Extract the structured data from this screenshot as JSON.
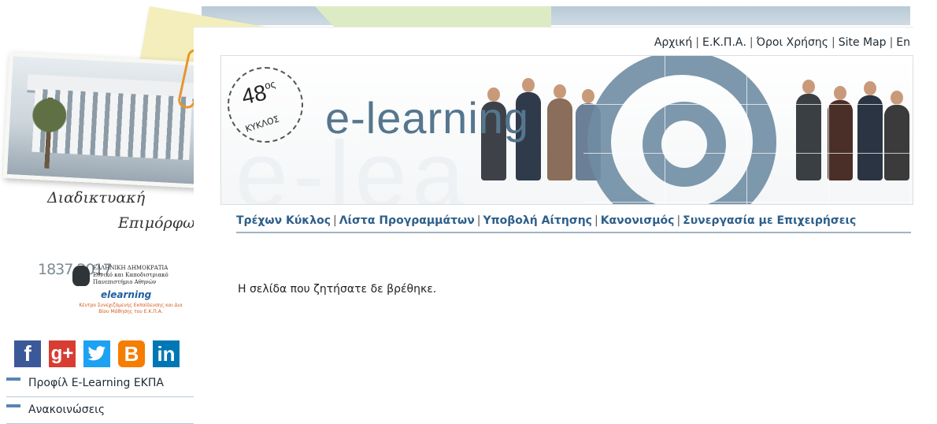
{
  "header": {
    "links": [
      {
        "label": "Αρχική"
      },
      {
        "label": "Ε.Κ.Π.Α."
      },
      {
        "label": "Όροι Χρήσης"
      },
      {
        "label": "Site Map"
      },
      {
        "label": "En"
      }
    ]
  },
  "banner": {
    "stamp_number": "48",
    "stamp_suffix": "ος",
    "stamp_word": "ΚΥΚΛΟΣ",
    "title": "e-learning",
    "watermark": "e-lea"
  },
  "sidebar": {
    "handwriting_line1": "Διαδικτυακή",
    "handwriting_line2": "Επιμόρφωση",
    "logo": {
      "years": "1837 2017",
      "institution": "ΕΛΛΗΝΙΚΗ ΔΗΜΟΚΡΑΤΙΑ Εθνικό και Καποδιστριακό Πανεπιστήμιο Αθηνών",
      "brand": "elearning",
      "subtitle": "Κέντρο Συνεχιζόμενης Εκπαίδευσης και Δια Βίου Μάθησης του Ε.Κ.Π.Α."
    },
    "social": [
      {
        "icon": "facebook-icon",
        "glyph": "f"
      },
      {
        "icon": "google-plus-icon",
        "glyph": "g+"
      },
      {
        "icon": "twitter-icon",
        "glyph": "t"
      },
      {
        "icon": "blogger-icon",
        "glyph": "B"
      },
      {
        "icon": "linkedin-icon",
        "glyph": "in"
      }
    ],
    "nav": [
      {
        "label": "Προφίλ E-Learning ΕΚΠΑ"
      },
      {
        "label": "Ανακοινώσεις"
      }
    ]
  },
  "mainnav": {
    "items": [
      {
        "label": "Τρέχων Κύκλος"
      },
      {
        "label": "Λίστα Προγραμμάτων"
      },
      {
        "label": "Υποβολή Αίτησης"
      },
      {
        "label": "Κανονισμός"
      },
      {
        "label": "Συνεργασία με Επιχειρήσεις"
      }
    ]
  },
  "content": {
    "message": "Η σελίδα που ζητήσατε δε βρέθηκε."
  },
  "colors": {
    "nav_link": "#2d5f8a",
    "title": "#55768e",
    "facebook": "#3b5998",
    "google_plus": "#d73d32",
    "twitter": "#1da1f2",
    "blogger": "#f57d00",
    "linkedin": "#0077b5"
  }
}
